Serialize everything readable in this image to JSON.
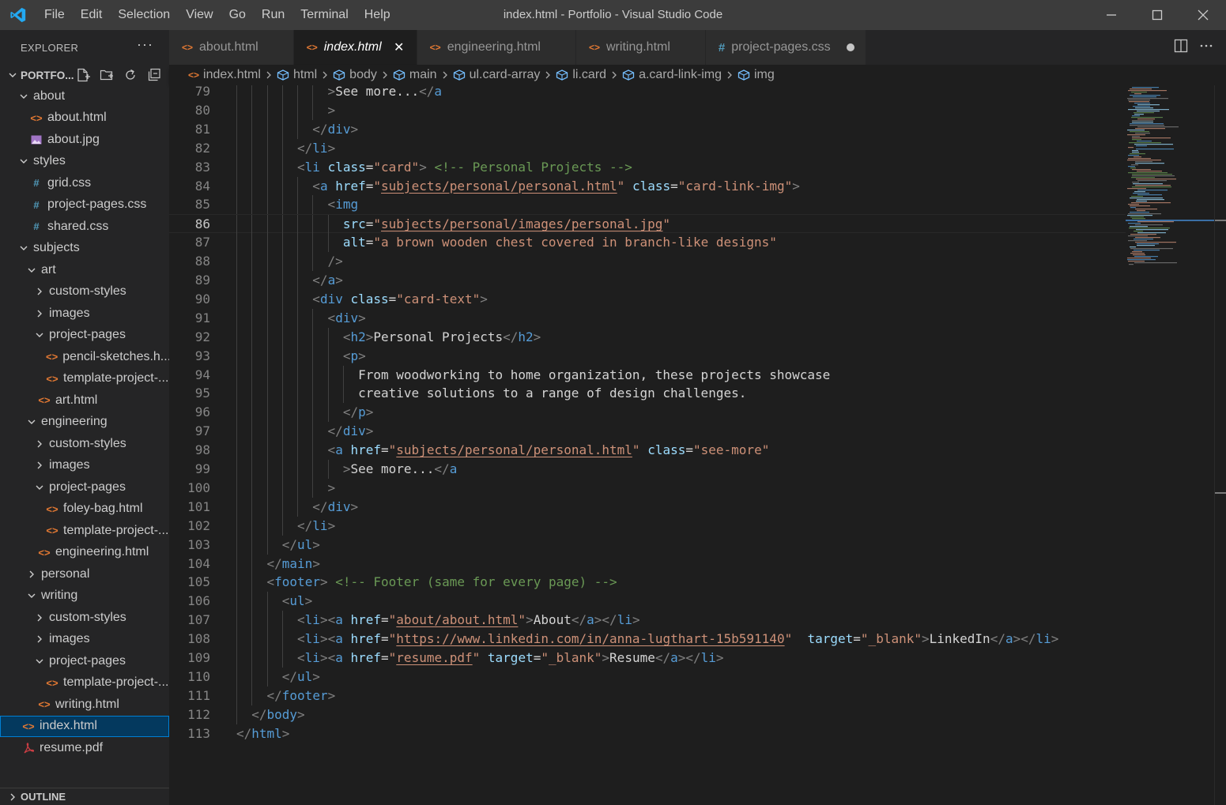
{
  "window": {
    "title": "index.html - Portfolio - Visual Studio Code",
    "menu": [
      "File",
      "Edit",
      "Selection",
      "View",
      "Go",
      "Run",
      "Terminal",
      "Help"
    ]
  },
  "sidebar": {
    "title": "EXPLORER",
    "more": "···",
    "section": "PORTFO...",
    "outline": "OUTLINE",
    "items": [
      {
        "label": "about",
        "depth": 1,
        "kind": "folder",
        "expanded": true
      },
      {
        "label": "about.html",
        "depth": 2,
        "kind": "html"
      },
      {
        "label": "about.jpg",
        "depth": 2,
        "kind": "image"
      },
      {
        "label": "styles",
        "depth": 1,
        "kind": "folder",
        "expanded": true
      },
      {
        "label": "grid.css",
        "depth": 2,
        "kind": "css"
      },
      {
        "label": "project-pages.css",
        "depth": 2,
        "kind": "css"
      },
      {
        "label": "shared.css",
        "depth": 2,
        "kind": "css"
      },
      {
        "label": "subjects",
        "depth": 1,
        "kind": "folder",
        "expanded": true
      },
      {
        "label": "art",
        "depth": 2,
        "kind": "folder",
        "expanded": true
      },
      {
        "label": "custom-styles",
        "depth": 3,
        "kind": "folder",
        "expanded": false
      },
      {
        "label": "images",
        "depth": 3,
        "kind": "folder",
        "expanded": false
      },
      {
        "label": "project-pages",
        "depth": 3,
        "kind": "folder",
        "expanded": true
      },
      {
        "label": "pencil-sketches.h...",
        "depth": 4,
        "kind": "html"
      },
      {
        "label": "template-project-...",
        "depth": 4,
        "kind": "html"
      },
      {
        "label": "art.html",
        "depth": 3,
        "kind": "html"
      },
      {
        "label": "engineering",
        "depth": 2,
        "kind": "folder",
        "expanded": true
      },
      {
        "label": "custom-styles",
        "depth": 3,
        "kind": "folder",
        "expanded": false
      },
      {
        "label": "images",
        "depth": 3,
        "kind": "folder",
        "expanded": false
      },
      {
        "label": "project-pages",
        "depth": 3,
        "kind": "folder",
        "expanded": true
      },
      {
        "label": "foley-bag.html",
        "depth": 4,
        "kind": "html"
      },
      {
        "label": "template-project-...",
        "depth": 4,
        "kind": "html"
      },
      {
        "label": "engineering.html",
        "depth": 3,
        "kind": "html"
      },
      {
        "label": "personal",
        "depth": 2,
        "kind": "folder",
        "expanded": false
      },
      {
        "label": "writing",
        "depth": 2,
        "kind": "folder",
        "expanded": true
      },
      {
        "label": "custom-styles",
        "depth": 3,
        "kind": "folder",
        "expanded": false
      },
      {
        "label": "images",
        "depth": 3,
        "kind": "folder",
        "expanded": false
      },
      {
        "label": "project-pages",
        "depth": 3,
        "kind": "folder",
        "expanded": true
      },
      {
        "label": "template-project-...",
        "depth": 4,
        "kind": "html"
      },
      {
        "label": "writing.html",
        "depth": 3,
        "kind": "html"
      },
      {
        "label": "index.html",
        "depth": 1,
        "kind": "html",
        "selected": true
      },
      {
        "label": "resume.pdf",
        "depth": 1,
        "kind": "pdf"
      }
    ]
  },
  "tabs": [
    {
      "label": "about.html",
      "kind": "html",
      "active": false
    },
    {
      "label": "index.html",
      "kind": "html",
      "active": true,
      "close": "✕"
    },
    {
      "label": "engineering.html",
      "kind": "html",
      "active": false
    },
    {
      "label": "writing.html",
      "kind": "html",
      "active": false
    },
    {
      "label": "project-pages.css",
      "kind": "css",
      "active": false,
      "dirty": true
    }
  ],
  "breadcrumb": [
    "index.html",
    "html",
    "body",
    "main",
    "ul.card-array",
    "li.card",
    "a.card-link-img",
    "img"
  ],
  "editor": {
    "current_line": 86,
    "lines": [
      {
        "n": "79",
        "indent": 12,
        "tokens": [
          [
            "br",
            ">"
          ],
          [
            "txt",
            "See more..."
          ],
          [
            "br",
            "</"
          ],
          [
            "tag",
            "a"
          ]
        ]
      },
      {
        "n": "80",
        "indent": 12,
        "tokens": [
          [
            "br",
            ">"
          ]
        ]
      },
      {
        "n": "81",
        "indent": 10,
        "tokens": [
          [
            "br",
            "</"
          ],
          [
            "tag",
            "div"
          ],
          [
            "br",
            ">"
          ]
        ]
      },
      {
        "n": "82",
        "indent": 8,
        "tokens": [
          [
            "br",
            "</"
          ],
          [
            "tag",
            "li"
          ],
          [
            "br",
            ">"
          ]
        ]
      },
      {
        "n": "83",
        "indent": 8,
        "tokens": [
          [
            "br",
            "<"
          ],
          [
            "tag",
            "li"
          ],
          [
            "txt",
            " "
          ],
          [
            "attr",
            "class"
          ],
          [
            "txt",
            "="
          ],
          [
            "str",
            "\"card\""
          ],
          [
            "br",
            ">"
          ],
          [
            "txt",
            " "
          ],
          [
            "com",
            "<!-- Personal Projects -->"
          ]
        ]
      },
      {
        "n": "84",
        "indent": 10,
        "tokens": [
          [
            "br",
            "<"
          ],
          [
            "tag",
            "a"
          ],
          [
            "txt",
            " "
          ],
          [
            "attr",
            "href"
          ],
          [
            "txt",
            "="
          ],
          [
            "str",
            "\""
          ],
          [
            "link",
            "subjects/personal/personal.html"
          ],
          [
            "str",
            "\""
          ],
          [
            "txt",
            " "
          ],
          [
            "attr",
            "class"
          ],
          [
            "txt",
            "="
          ],
          [
            "str",
            "\"card-link-img\""
          ],
          [
            "br",
            ">"
          ]
        ]
      },
      {
        "n": "85",
        "indent": 12,
        "tokens": [
          [
            "br",
            "<"
          ],
          [
            "tag",
            "img"
          ]
        ]
      },
      {
        "n": "86",
        "indent": 14,
        "tokens": [
          [
            "attr",
            "src"
          ],
          [
            "txt",
            "="
          ],
          [
            "str",
            "\""
          ],
          [
            "link",
            "subjects/personal/images/personal.jpg"
          ],
          [
            "str",
            "\""
          ]
        ]
      },
      {
        "n": "87",
        "indent": 14,
        "tokens": [
          [
            "attr",
            "alt"
          ],
          [
            "txt",
            "="
          ],
          [
            "str",
            "\"a brown wooden chest covered in branch-like designs\""
          ]
        ]
      },
      {
        "n": "88",
        "indent": 12,
        "tokens": [
          [
            "br",
            "/>"
          ]
        ]
      },
      {
        "n": "89",
        "indent": 10,
        "tokens": [
          [
            "br",
            "</"
          ],
          [
            "tag",
            "a"
          ],
          [
            "br",
            ">"
          ]
        ]
      },
      {
        "n": "90",
        "indent": 10,
        "tokens": [
          [
            "br",
            "<"
          ],
          [
            "tag",
            "div"
          ],
          [
            "txt",
            " "
          ],
          [
            "attr",
            "class"
          ],
          [
            "txt",
            "="
          ],
          [
            "str",
            "\"card-text\""
          ],
          [
            "br",
            ">"
          ]
        ]
      },
      {
        "n": "91",
        "indent": 12,
        "tokens": [
          [
            "br",
            "<"
          ],
          [
            "tag",
            "div"
          ],
          [
            "br",
            ">"
          ]
        ]
      },
      {
        "n": "92",
        "indent": 14,
        "tokens": [
          [
            "br",
            "<"
          ],
          [
            "tag",
            "h2"
          ],
          [
            "br",
            ">"
          ],
          [
            "txt",
            "Personal Projects"
          ],
          [
            "br",
            "</"
          ],
          [
            "tag",
            "h2"
          ],
          [
            "br",
            ">"
          ]
        ]
      },
      {
        "n": "93",
        "indent": 14,
        "tokens": [
          [
            "br",
            "<"
          ],
          [
            "tag",
            "p"
          ],
          [
            "br",
            ">"
          ]
        ]
      },
      {
        "n": "94",
        "indent": 16,
        "tokens": [
          [
            "txt",
            "From woodworking to home organization, these projects showcase"
          ]
        ]
      },
      {
        "n": "95",
        "indent": 16,
        "tokens": [
          [
            "txt",
            "creative solutions to a range of design challenges."
          ]
        ]
      },
      {
        "n": "96",
        "indent": 14,
        "tokens": [
          [
            "br",
            "</"
          ],
          [
            "tag",
            "p"
          ],
          [
            "br",
            ">"
          ]
        ]
      },
      {
        "n": "97",
        "indent": 12,
        "tokens": [
          [
            "br",
            "</"
          ],
          [
            "tag",
            "div"
          ],
          [
            "br",
            ">"
          ]
        ]
      },
      {
        "n": "98",
        "indent": 12,
        "tokens": [
          [
            "br",
            "<"
          ],
          [
            "tag",
            "a"
          ],
          [
            "txt",
            " "
          ],
          [
            "attr",
            "href"
          ],
          [
            "txt",
            "="
          ],
          [
            "str",
            "\""
          ],
          [
            "link",
            "subjects/personal/personal.html"
          ],
          [
            "str",
            "\""
          ],
          [
            "txt",
            " "
          ],
          [
            "attr",
            "class"
          ],
          [
            "txt",
            "="
          ],
          [
            "str",
            "\"see-more\""
          ]
        ]
      },
      {
        "n": "99",
        "indent": 14,
        "tokens": [
          [
            "br",
            ">"
          ],
          [
            "txt",
            "See more..."
          ],
          [
            "br",
            "</"
          ],
          [
            "tag",
            "a"
          ]
        ]
      },
      {
        "n": "100",
        "indent": 12,
        "tokens": [
          [
            "br",
            ">"
          ]
        ]
      },
      {
        "n": "101",
        "indent": 10,
        "tokens": [
          [
            "br",
            "</"
          ],
          [
            "tag",
            "div"
          ],
          [
            "br",
            ">"
          ]
        ]
      },
      {
        "n": "102",
        "indent": 8,
        "tokens": [
          [
            "br",
            "</"
          ],
          [
            "tag",
            "li"
          ],
          [
            "br",
            ">"
          ]
        ]
      },
      {
        "n": "103",
        "indent": 6,
        "tokens": [
          [
            "br",
            "</"
          ],
          [
            "tag",
            "ul"
          ],
          [
            "br",
            ">"
          ]
        ]
      },
      {
        "n": "104",
        "indent": 4,
        "tokens": [
          [
            "br",
            "</"
          ],
          [
            "tag",
            "main"
          ],
          [
            "br",
            ">"
          ]
        ]
      },
      {
        "n": "105",
        "indent": 4,
        "tokens": [
          [
            "br",
            "<"
          ],
          [
            "tag",
            "footer"
          ],
          [
            "br",
            ">"
          ],
          [
            "txt",
            " "
          ],
          [
            "com",
            "<!-- Footer (same for every page) -->"
          ]
        ]
      },
      {
        "n": "106",
        "indent": 6,
        "tokens": [
          [
            "br",
            "<"
          ],
          [
            "tag",
            "ul"
          ],
          [
            "br",
            ">"
          ]
        ]
      },
      {
        "n": "107",
        "indent": 8,
        "tokens": [
          [
            "br",
            "<"
          ],
          [
            "tag",
            "li"
          ],
          [
            "br",
            "><"
          ],
          [
            "tag",
            "a"
          ],
          [
            "txt",
            " "
          ],
          [
            "attr",
            "href"
          ],
          [
            "txt",
            "="
          ],
          [
            "str",
            "\""
          ],
          [
            "link",
            "about/about.html"
          ],
          [
            "str",
            "\""
          ],
          [
            "br",
            ">"
          ],
          [
            "txt",
            "About"
          ],
          [
            "br",
            "</"
          ],
          [
            "tag",
            "a"
          ],
          [
            "br",
            "></"
          ],
          [
            "tag",
            "li"
          ],
          [
            "br",
            ">"
          ]
        ]
      },
      {
        "n": "108",
        "indent": 8,
        "tokens": [
          [
            "br",
            "<"
          ],
          [
            "tag",
            "li"
          ],
          [
            "br",
            "><"
          ],
          [
            "tag",
            "a"
          ],
          [
            "txt",
            " "
          ],
          [
            "attr",
            "href"
          ],
          [
            "txt",
            "="
          ],
          [
            "str",
            "\""
          ],
          [
            "link",
            "https://www.linkedin.com/in/anna-lugthart-15b591140"
          ],
          [
            "str",
            "\""
          ],
          [
            "txt",
            "  "
          ],
          [
            "attr",
            "target"
          ],
          [
            "txt",
            "="
          ],
          [
            "str",
            "\"_blank\""
          ],
          [
            "br",
            ">"
          ],
          [
            "txt",
            "LinkedIn"
          ],
          [
            "br",
            "</"
          ],
          [
            "tag",
            "a"
          ],
          [
            "br",
            "></"
          ],
          [
            "tag",
            "li"
          ],
          [
            "br",
            ">"
          ]
        ]
      },
      {
        "n": "109",
        "indent": 8,
        "tokens": [
          [
            "br",
            "<"
          ],
          [
            "tag",
            "li"
          ],
          [
            "br",
            "><"
          ],
          [
            "tag",
            "a"
          ],
          [
            "txt",
            " "
          ],
          [
            "attr",
            "href"
          ],
          [
            "txt",
            "="
          ],
          [
            "str",
            "\""
          ],
          [
            "link",
            "resume.pdf"
          ],
          [
            "str",
            "\""
          ],
          [
            "txt",
            " "
          ],
          [
            "attr",
            "target"
          ],
          [
            "txt",
            "="
          ],
          [
            "str",
            "\"_blank\""
          ],
          [
            "br",
            ">"
          ],
          [
            "txt",
            "Resume"
          ],
          [
            "br",
            "</"
          ],
          [
            "tag",
            "a"
          ],
          [
            "br",
            "></"
          ],
          [
            "tag",
            "li"
          ],
          [
            "br",
            ">"
          ]
        ]
      },
      {
        "n": "110",
        "indent": 6,
        "tokens": [
          [
            "br",
            "</"
          ],
          [
            "tag",
            "ul"
          ],
          [
            "br",
            ">"
          ]
        ]
      },
      {
        "n": "111",
        "indent": 4,
        "tokens": [
          [
            "br",
            "</"
          ],
          [
            "tag",
            "footer"
          ],
          [
            "br",
            ">"
          ]
        ]
      },
      {
        "n": "112",
        "indent": 2,
        "tokens": [
          [
            "br",
            "</"
          ],
          [
            "tag",
            "body"
          ],
          [
            "br",
            ">"
          ]
        ]
      },
      {
        "n": "113",
        "indent": 0,
        "tokens": [
          [
            "br",
            "</"
          ],
          [
            "tag",
            "html"
          ],
          [
            "br",
            ">"
          ]
        ]
      }
    ]
  },
  "colors": {
    "titlebar": "#3c3c3c",
    "sidebar": "#252526",
    "editor": "#1e1e1e",
    "accent": "#007acc",
    "selection": "#04395e"
  }
}
